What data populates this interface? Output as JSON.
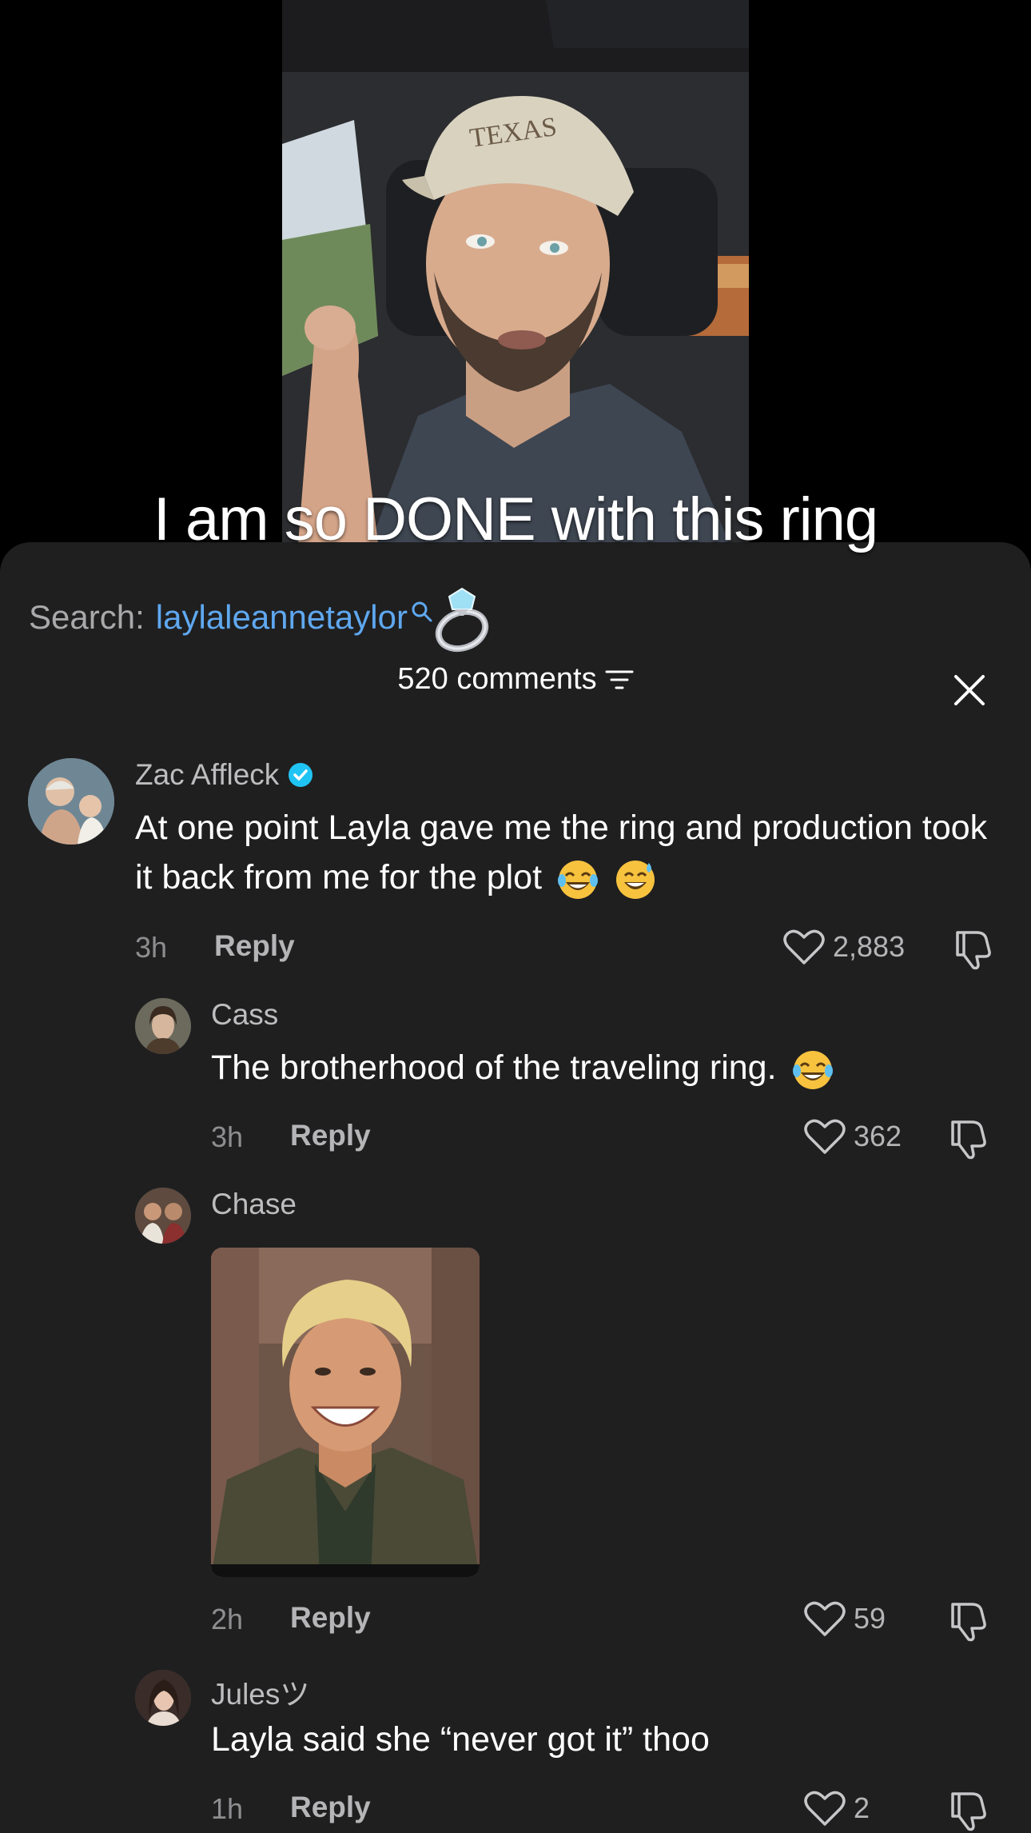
{
  "video": {
    "caption": "I am so DONE with this ring"
  },
  "search": {
    "label": "Search:",
    "term": "laylaleannetaylor"
  },
  "header": {
    "comment_count": "520 comments"
  },
  "comments": [
    {
      "username": "Zac Affleck",
      "verified": true,
      "text": "At one point Layla gave me the ring and production took it back from me for the plot",
      "time": "3h",
      "reply_label": "Reply",
      "likes": "2,883"
    },
    {
      "username": "Cass",
      "text": "The brotherhood of the traveling ring.",
      "time": "3h",
      "reply_label": "Reply",
      "likes": "362"
    },
    {
      "username": "Chase",
      "time": "2h",
      "reply_label": "Reply",
      "likes": "59"
    },
    {
      "username": "Julesツ",
      "text": "Layla said she “never got it” thoo",
      "time": "1h",
      "reply_label": "Reply",
      "likes": "2"
    }
  ],
  "colors": {
    "sheet_bg": "#1f1f20",
    "link_blue": "#5fa8f0",
    "verified_blue": "#20c4f4"
  }
}
